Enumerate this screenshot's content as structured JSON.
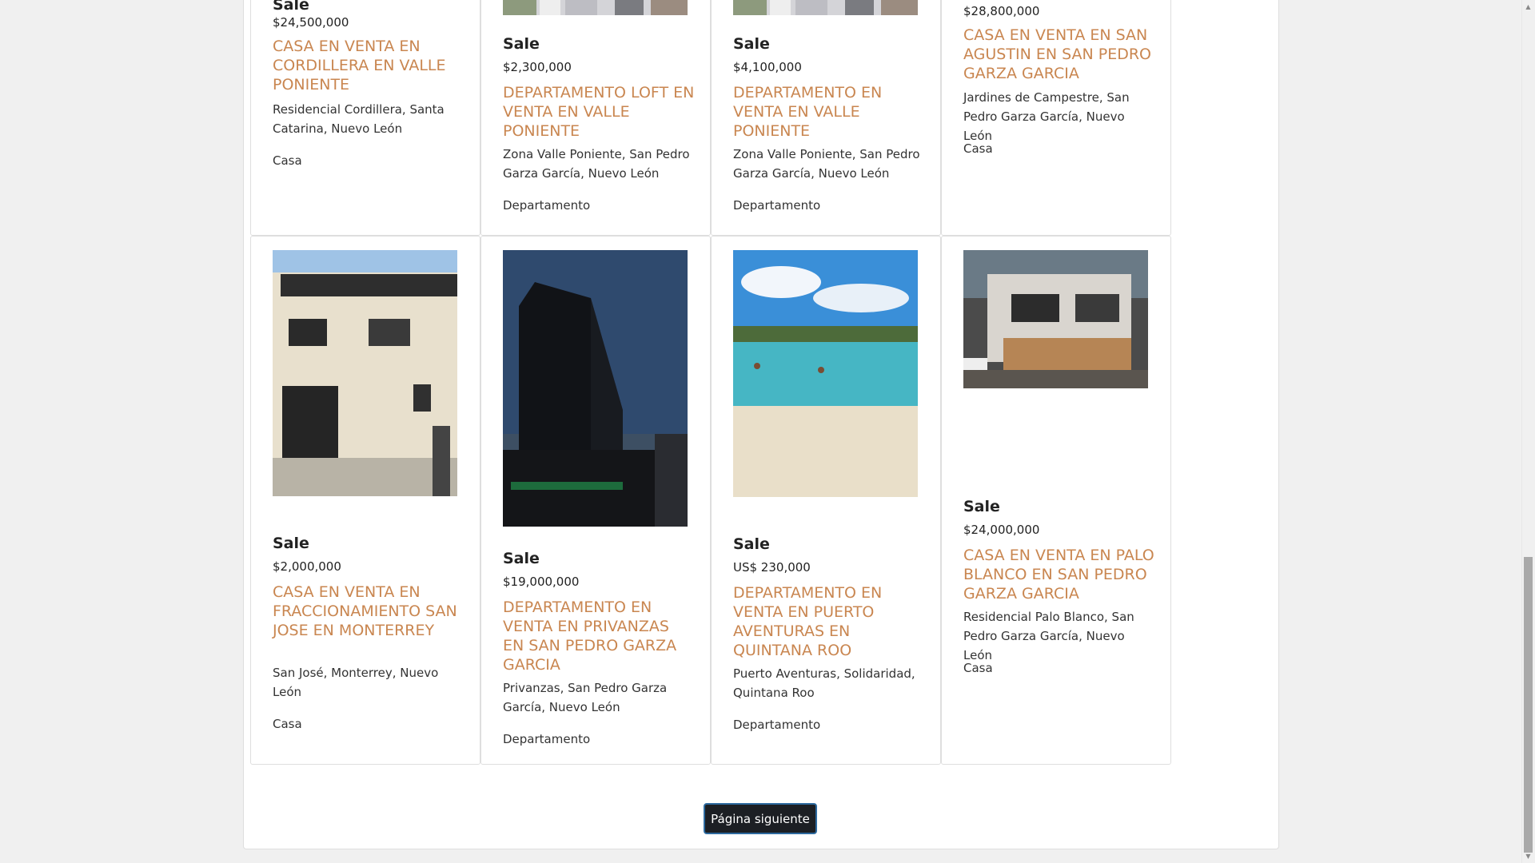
{
  "listings": [
    {
      "sale": "Sale",
      "price": "$24,500,000",
      "title": "CASA EN VENTA EN CORDILLERA EN VALLE PONIENTE",
      "location": "Residencial Cordillera, Santa Catarina, Nuevo León",
      "type": "Casa"
    },
    {
      "sale": "Sale",
      "price": "$2,300,000",
      "title": "DEPARTAMENTO LOFT EN VENTA EN VALLE PONIENTE",
      "location": "Zona Valle Poniente, San Pedro Garza García, Nuevo León",
      "type": "Departamento"
    },
    {
      "sale": "Sale",
      "price": "$4,100,000",
      "title": "DEPARTAMENTO EN VENTA EN VALLE PONIENTE",
      "location": "Zona Valle Poniente, San Pedro Garza García, Nuevo León",
      "type": "Departamento"
    },
    {
      "price": "$28,800,000",
      "title": "CASA EN VENTA EN SAN AGUSTIN EN SAN PEDRO GARZA GARCIA",
      "location": "Jardines de Campestre, San Pedro Garza García, Nuevo León",
      "type": "Casa"
    },
    {
      "sale": "Sale",
      "price": "$2,000,000",
      "title": "CASA EN VENTA EN FRACCIONAMIENTO SAN JOSE EN MONTERREY",
      "location": "San José, Monterrey, Nuevo León",
      "type": "Casa"
    },
    {
      "sale": "Sale",
      "price": "$19,000,000",
      "title": "DEPARTAMENTO EN VENTA EN PRIVANZAS EN SAN PEDRO GARZA GARCIA",
      "location": "Privanzas, San Pedro Garza García, Nuevo León",
      "type": "Departamento"
    },
    {
      "sale": "Sale",
      "price": "US$ 230,000",
      "title": "DEPARTAMENTO EN VENTA EN PUERTO AVENTURAS EN QUINTANA ROO",
      "location": "Puerto Aventuras, Solidaridad, Quintana Roo",
      "type": "Departamento"
    },
    {
      "sale": "Sale",
      "price": "$24,000,000",
      "title": "CASA EN VENTA EN PALO BLANCO EN SAN PEDRO GARZA GARCIA",
      "location": "Residencial Palo Blanco, San Pedro Garza García, Nuevo León",
      "type": "Casa"
    }
  ],
  "pagination": {
    "next_label": "Página siguiente"
  },
  "colors": {
    "title_accent": "#c98650",
    "button_bg": "#1c1f24",
    "button_border": "#2d6a9f"
  }
}
